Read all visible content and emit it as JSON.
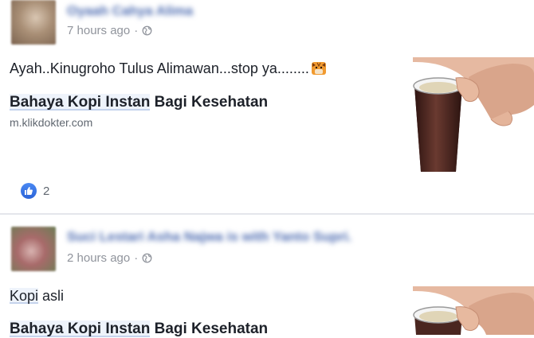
{
  "posts": [
    {
      "author": "Oyaah Cahya Alima",
      "time": "7 hours ago",
      "separator": "·",
      "text": "Ayah..Kinugroho Tulus Alimawan...stop ya........",
      "emoji": "tiger-face",
      "link": {
        "title_highlight": "Bahaya Kopi Instan",
        "title_rest": " Bagi Kesehatan",
        "domain": "m.klikdokter.com"
      },
      "likes": "2"
    },
    {
      "author": "Suci Lestari Asha Najwa is with Yanto Supri.",
      "time": "2 hours ago",
      "separator": "·",
      "text_highlight": "Kopi",
      "text_rest": " asli",
      "link": {
        "title_highlight": "Bahaya Kopi Instan",
        "title_rest": " Bagi Kesehatan"
      }
    }
  ],
  "colors": {
    "link_highlight_bg": "#eef3fb",
    "like_blue": "#2c64d8",
    "meta_gray": "#90949c"
  }
}
